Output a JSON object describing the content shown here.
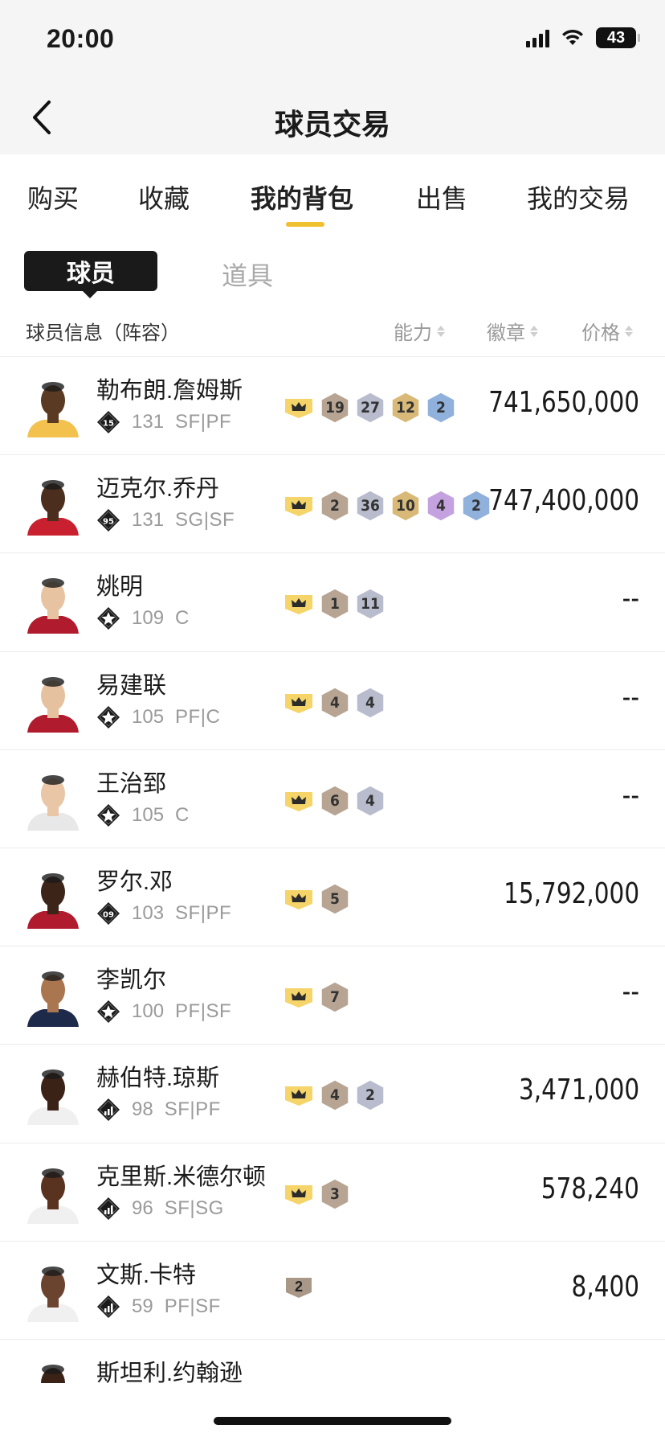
{
  "status": {
    "time": "20:00",
    "battery": "43"
  },
  "nav": {
    "title": "球员交易"
  },
  "tabs": [
    {
      "label": "购买",
      "active": false
    },
    {
      "label": "收藏",
      "active": false
    },
    {
      "label": "我的背包",
      "active": true
    },
    {
      "label": "出售",
      "active": false
    },
    {
      "label": "我的交易",
      "active": false
    }
  ],
  "segments": {
    "players": "球员",
    "items": "道具"
  },
  "list_header": {
    "info": "球员信息（阵容）",
    "ability": "能力",
    "badge": "徽章",
    "price": "价格"
  },
  "players": [
    {
      "name": "勒布朗.詹姆斯",
      "tier": "15",
      "ovr": "131",
      "pos": "SF|PF",
      "skin": "#5a3a22",
      "jersey": "#f2c14e",
      "badges": [
        {
          "v": "19",
          "c": "#b7a493"
        },
        {
          "v": "27",
          "c": "#b9bccd"
        },
        {
          "v": "12",
          "c": "#d9b978"
        },
        {
          "v": "2",
          "c": "#8fb1dc"
        }
      ],
      "price": "741,650,000",
      "crown": true
    },
    {
      "name": "迈克尔.乔丹",
      "tier": "95",
      "ovr": "131",
      "pos": "SG|SF",
      "skin": "#4b2e1e",
      "jersey": "#c8202f",
      "badges": [
        {
          "v": "2",
          "c": "#b7a493"
        },
        {
          "v": "36",
          "c": "#b9bccd"
        },
        {
          "v": "10",
          "c": "#d9b978"
        },
        {
          "v": "4",
          "c": "#c4a2e0"
        },
        {
          "v": "2",
          "c": "#8fb1dc"
        }
      ],
      "price": "747,400,000",
      "crown": true
    },
    {
      "name": "姚明",
      "tier": "",
      "ovr": "109",
      "pos": "C",
      "skin": "#e7c3a2",
      "jersey": "#b01c2e",
      "badges": [
        {
          "v": "1",
          "c": "#b7a493"
        },
        {
          "v": "11",
          "c": "#b9bccd"
        }
      ],
      "price": "--",
      "crown": true
    },
    {
      "name": "易建联",
      "tier": "",
      "ovr": "105",
      "pos": "PF|C",
      "skin": "#e5c19f",
      "jersey": "#b01c2e",
      "badges": [
        {
          "v": "4",
          "c": "#b7a493"
        },
        {
          "v": "4",
          "c": "#b9bccd"
        }
      ],
      "price": "--",
      "crown": true
    },
    {
      "name": "王治郅",
      "tier": "",
      "ovr": "105",
      "pos": "C",
      "skin": "#e8c6a6",
      "jersey": "#e8e8e8",
      "badges": [
        {
          "v": "6",
          "c": "#b7a493"
        },
        {
          "v": "4",
          "c": "#b9bccd"
        }
      ],
      "price": "--",
      "crown": true
    },
    {
      "name": "罗尔.邓",
      "tier": "09",
      "ovr": "103",
      "pos": "SF|PF",
      "skin": "#3d2418",
      "jersey": "#b01c2e",
      "badges": [
        {
          "v": "5",
          "c": "#b7a493"
        }
      ],
      "price": "15,792,000",
      "crown": true
    },
    {
      "name": "李凯尔",
      "tier": "",
      "ovr": "100",
      "pos": "PF|SF",
      "skin": "#a9764f",
      "jersey": "#1e2a4a",
      "badges": [
        {
          "v": "7",
          "c": "#b7a493"
        }
      ],
      "price": "--",
      "crown": true
    },
    {
      "name": "赫伯特.琼斯",
      "tier": "bars",
      "ovr": "98",
      "pos": "SF|PF",
      "skin": "#3a2216",
      "jersey": "#f0f0f0",
      "badges": [
        {
          "v": "4",
          "c": "#b7a493"
        },
        {
          "v": "2",
          "c": "#b9bccd"
        }
      ],
      "price": "3,471,000",
      "crown": true
    },
    {
      "name": "克里斯.米德尔顿",
      "tier": "bars",
      "ovr": "96",
      "pos": "SF|SG",
      "skin": "#5a3220",
      "jersey": "#f0f0f0",
      "badges": [
        {
          "v": "3",
          "c": "#b7a493"
        }
      ],
      "price": "578,240",
      "crown": true
    },
    {
      "name": "文斯.卡特",
      "tier": "bars",
      "ovr": "59",
      "pos": "PF|SF",
      "skin": "#6b4430",
      "jersey": "#f0f0f0",
      "badges": [],
      "rank": "2",
      "price": "8,400",
      "crown": false
    },
    {
      "name": "斯坦利.约翰逊",
      "tier": "bars",
      "ovr": "",
      "pos": "",
      "skin": "#3a2216",
      "jersey": "#f0f0f0",
      "badges": [],
      "price": "",
      "crown": false
    }
  ]
}
